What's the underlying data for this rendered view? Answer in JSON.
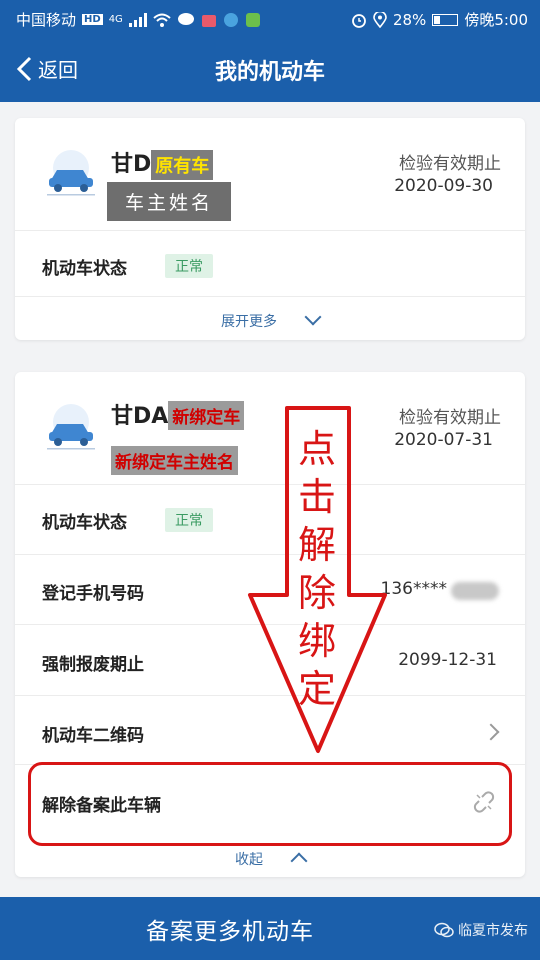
{
  "status_bar": {
    "carrier": "中国移动",
    "hd": "HD",
    "signal": "4G",
    "battery": "28%",
    "time": "傍晚5:00",
    "battery_level": 0.28
  },
  "nav": {
    "back_label": "返回",
    "title": "我的机动车"
  },
  "vehicles": [
    {
      "plate": "甘D",
      "plate_overlay": "原有车",
      "owner_overlay": "车主姓名",
      "inspection_label": "检验有效期止",
      "inspection_date": "2020-09-30",
      "status_label": "机动车状态",
      "status_badge": "正常",
      "expand_label": "展开更多"
    },
    {
      "plate": "甘DA",
      "plate_overlay": "新绑定车",
      "owner_overlay": "新绑定车主姓名",
      "inspection_label": "检验有效期止",
      "inspection_date": "2020-07-31",
      "status_label": "机动车状态",
      "status_badge": "正常",
      "phone_label": "登记手机号码",
      "phone_value": "136****",
      "scrap_label": "强制报废期止",
      "scrap_value": "2099-12-31",
      "qr_label": "机动车二维码",
      "unbind_label": "解除备案此车辆",
      "collapse_label": "收起"
    }
  ],
  "annotation": {
    "chars": [
      "点",
      "击",
      "解",
      "除",
      "绑",
      "定"
    ]
  },
  "bottom_button": {
    "label": "备案更多机动车"
  },
  "watermark": {
    "text": "临夏市发布"
  },
  "colors": {
    "primary": "#1b5fab",
    "annotation_red": "#d81515",
    "badge_green": "#3a9b62"
  },
  "icons": [
    "back-arrow-icon",
    "car-icon",
    "chevron-down-icon",
    "chevron-up-icon",
    "chevron-right-icon",
    "unlink-icon",
    "battery-icon",
    "wifi-icon",
    "alarm-icon",
    "location-icon"
  ]
}
